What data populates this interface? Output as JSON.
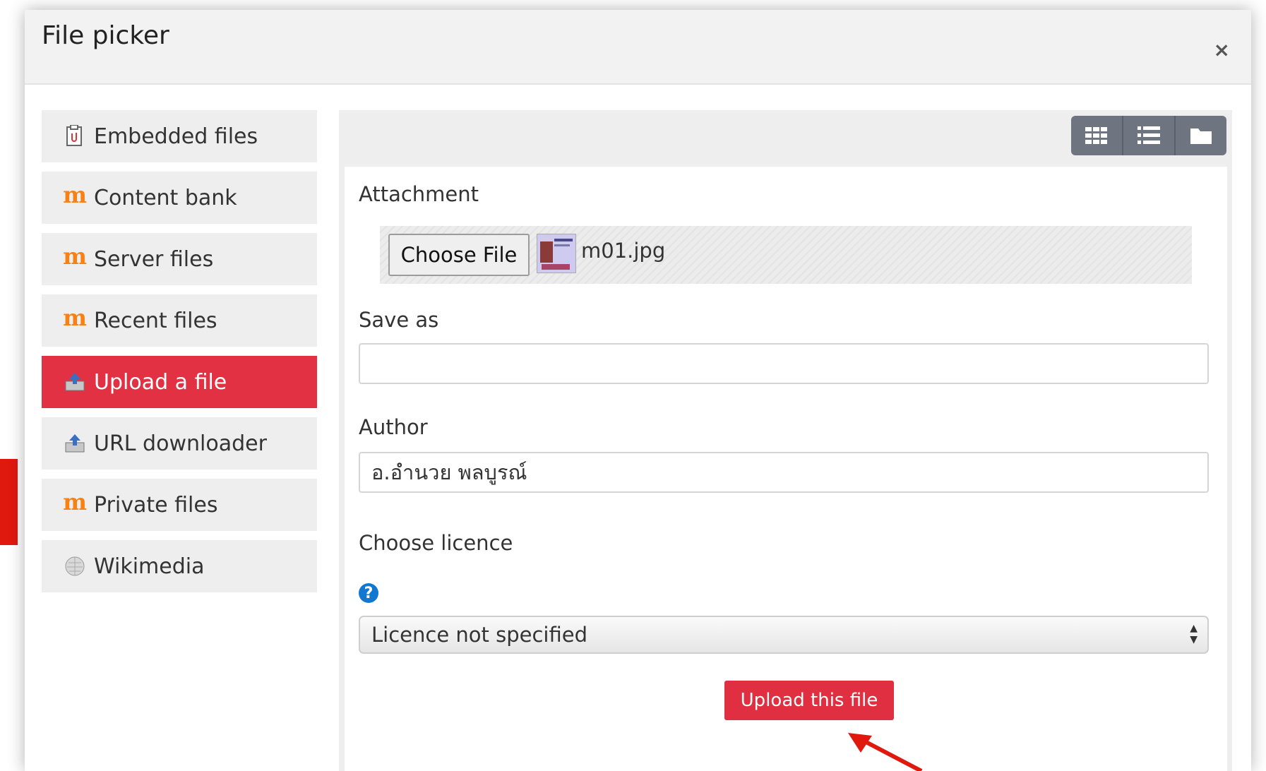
{
  "dialog": {
    "title": "File picker",
    "close_label": "×"
  },
  "sidebar": {
    "items": [
      {
        "label": "Embedded files",
        "icon": "embedded-files-icon"
      },
      {
        "label": "Content bank",
        "icon": "moodle-icon"
      },
      {
        "label": "Server files",
        "icon": "moodle-icon"
      },
      {
        "label": "Recent files",
        "icon": "moodle-icon"
      },
      {
        "label": "Upload a file",
        "icon": "upload-icon",
        "active": true
      },
      {
        "label": "URL downloader",
        "icon": "upload-icon"
      },
      {
        "label": "Private files",
        "icon": "moodle-icon"
      },
      {
        "label": "Wikimedia",
        "icon": "wikimedia-globe-icon"
      }
    ]
  },
  "toolbar": {
    "views": [
      "grid-view-icon",
      "list-view-icon",
      "folder-view-icon"
    ]
  },
  "form": {
    "attachment_label": "Attachment",
    "choose_file_label": "Choose File",
    "file_name": "m01.jpg",
    "save_as_label": "Save as",
    "save_as_value": "",
    "author_label": "Author",
    "author_value": "อ.อำนวย พลบูรณ์",
    "licence_label": "Choose licence",
    "licence_value": "Licence not specified",
    "upload_button": "Upload this file"
  },
  "colors": {
    "accent": "#e13143",
    "toolbar": "#6e7580",
    "help": "#1177d1",
    "moodle_orange": "#f98012",
    "annotation": "#e0190f"
  }
}
